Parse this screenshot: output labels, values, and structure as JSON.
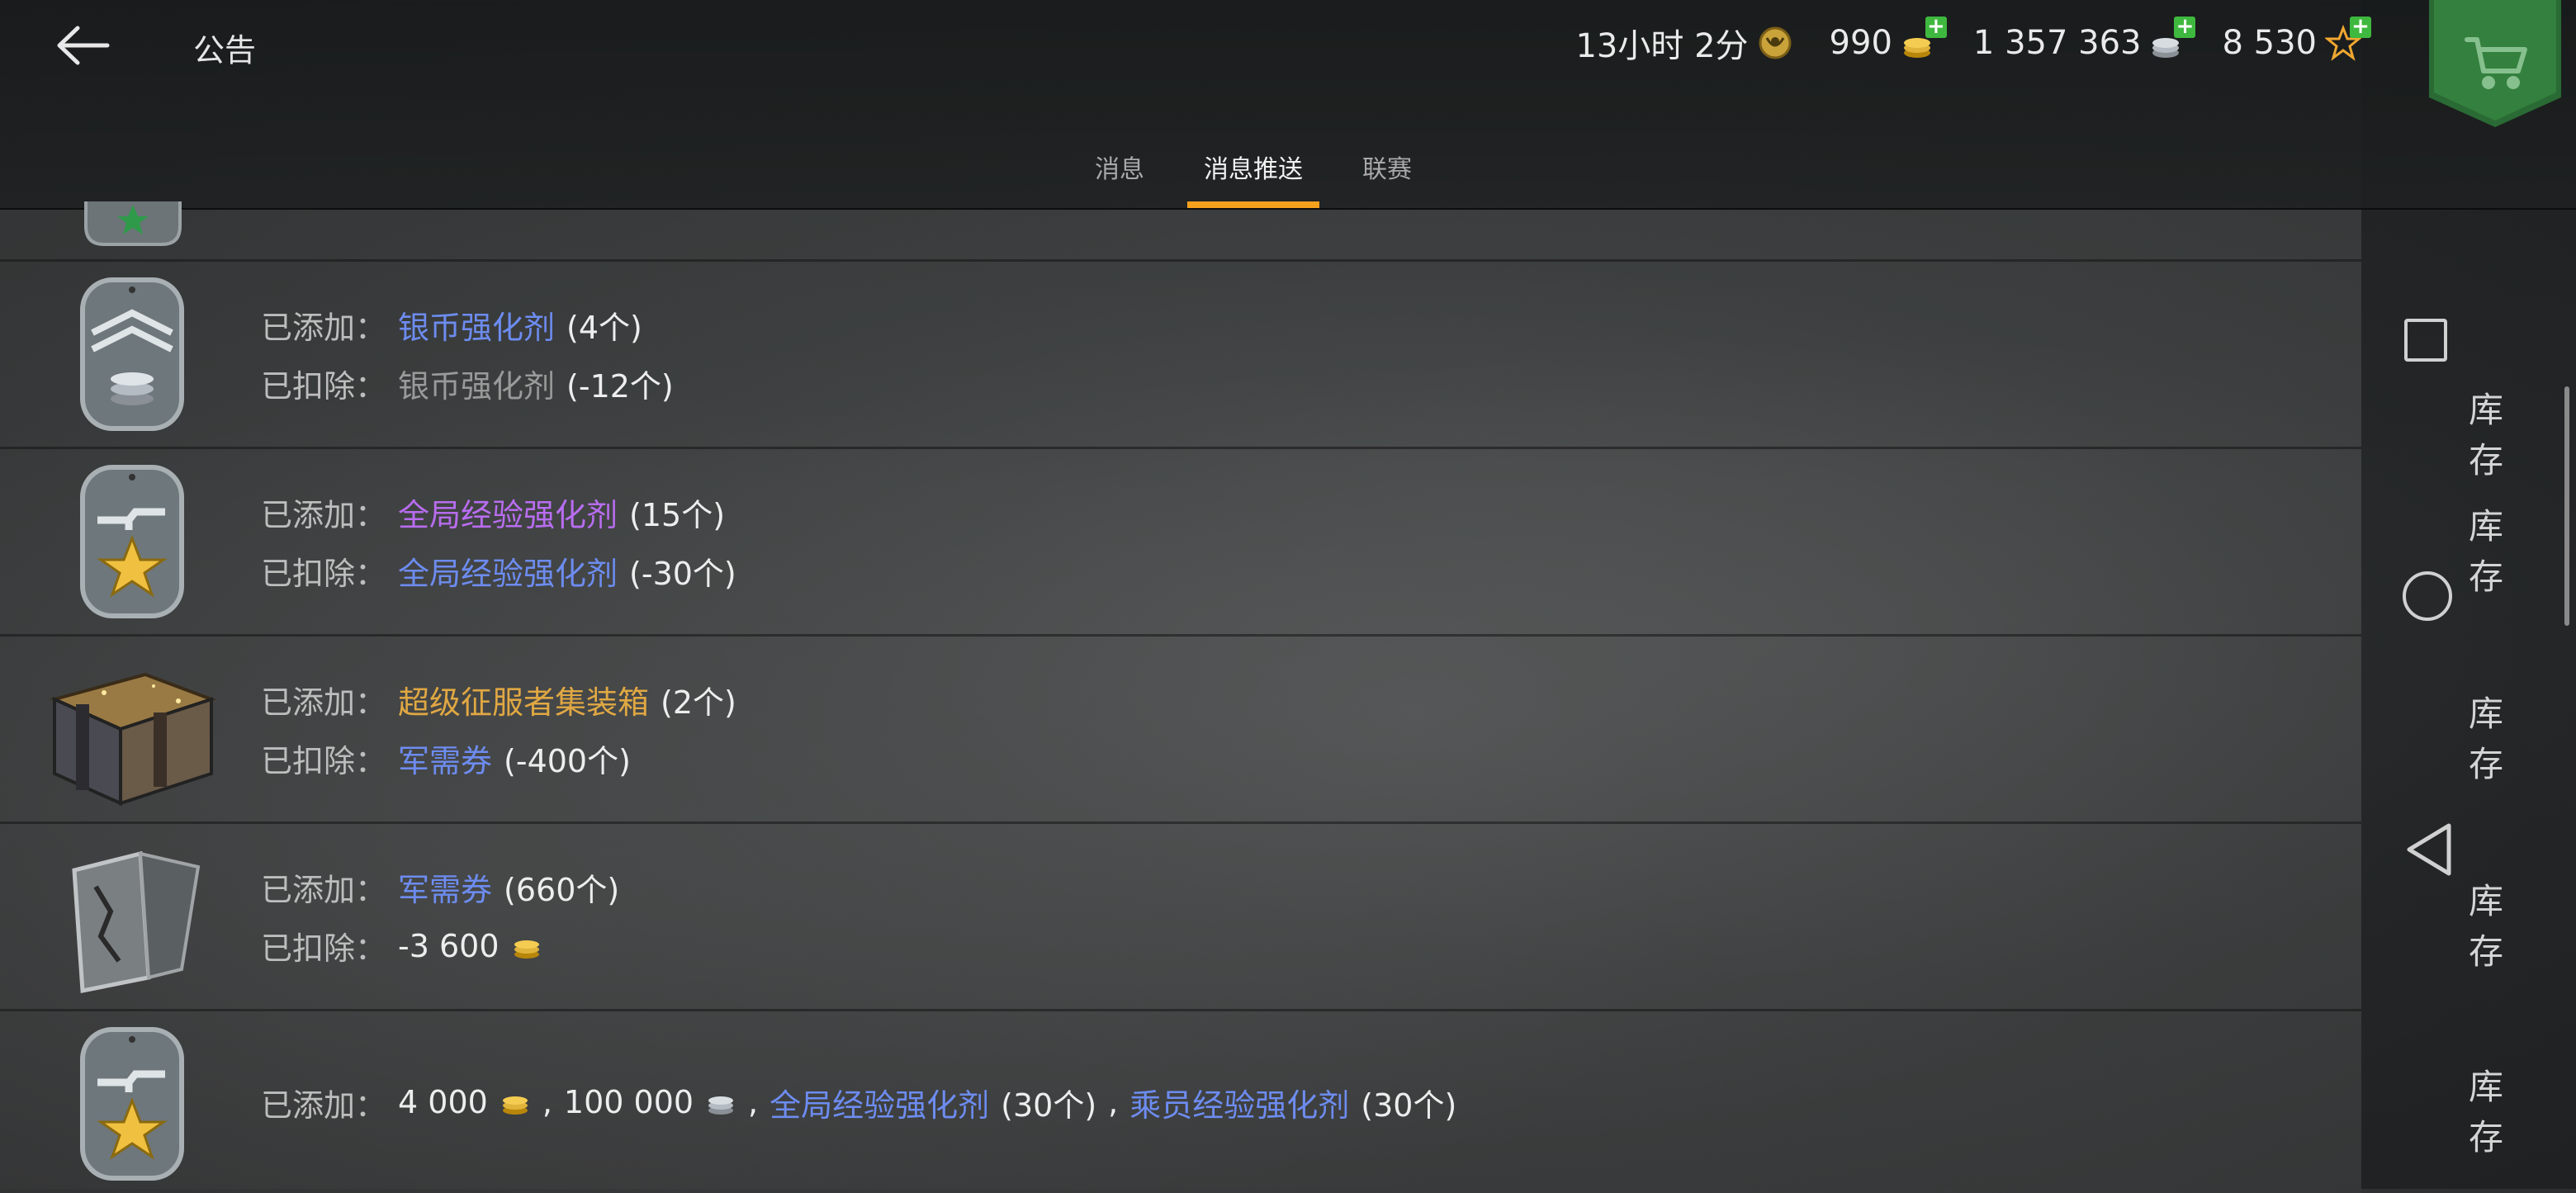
{
  "header": {
    "title": "公告",
    "timer": "13小时 2分",
    "gold": "990",
    "silver": "1 357 363",
    "free_xp": "8 530",
    "plus": "+"
  },
  "tabs": [
    {
      "label": "消息",
      "active": false
    },
    {
      "label": "消息推送",
      "active": true
    },
    {
      "label": "联赛",
      "active": false
    }
  ],
  "labels": {
    "added": "已添加：",
    "deducted": "已扣除：",
    "inventory": "库存",
    "sep": ","
  },
  "rows": [
    {
      "icon": "silver-booster-icon",
      "added": {
        "name": "银币强化剂",
        "qty": "(4个)",
        "color": "blue"
      },
      "deducted": {
        "name": "银币强化剂",
        "qty": "(-12个)",
        "color": "gray"
      }
    },
    {
      "icon": "global-xp-booster-icon",
      "added": {
        "name": "全局经验强化剂",
        "qty": "(15个)",
        "color": "purple"
      },
      "deducted": {
        "name": "全局经验强化剂",
        "qty": "(-30个)",
        "color": "blue"
      }
    },
    {
      "icon": "super-conqueror-crate-icon",
      "added": {
        "name": "超级征服者集装箱",
        "qty": "(2个)",
        "color": "orange"
      },
      "deducted": {
        "name": "军需券",
        "qty": "(-400个)",
        "color": "blue"
      }
    },
    {
      "icon": "quartermaster-ticket-icon",
      "added": {
        "name": "军需券",
        "qty": "(660个)",
        "color": "blue"
      },
      "deducted": {
        "amount": "-3 600"
      }
    },
    {
      "icon": "global-xp-booster-icon",
      "added_multi": {
        "gold": "4 000",
        "silver": "100 000",
        "item1": "全局经验强化剂",
        "item1_qty": "(30个)",
        "item2": "乘员经验强化剂",
        "item2_qty": "(30个)"
      }
    }
  ],
  "colors": {
    "accent": "#f4a11d",
    "blue": "#6d8cf0",
    "purple": "#b86df0",
    "orange": "#e0a843",
    "plus_green": "#3fb83f"
  }
}
